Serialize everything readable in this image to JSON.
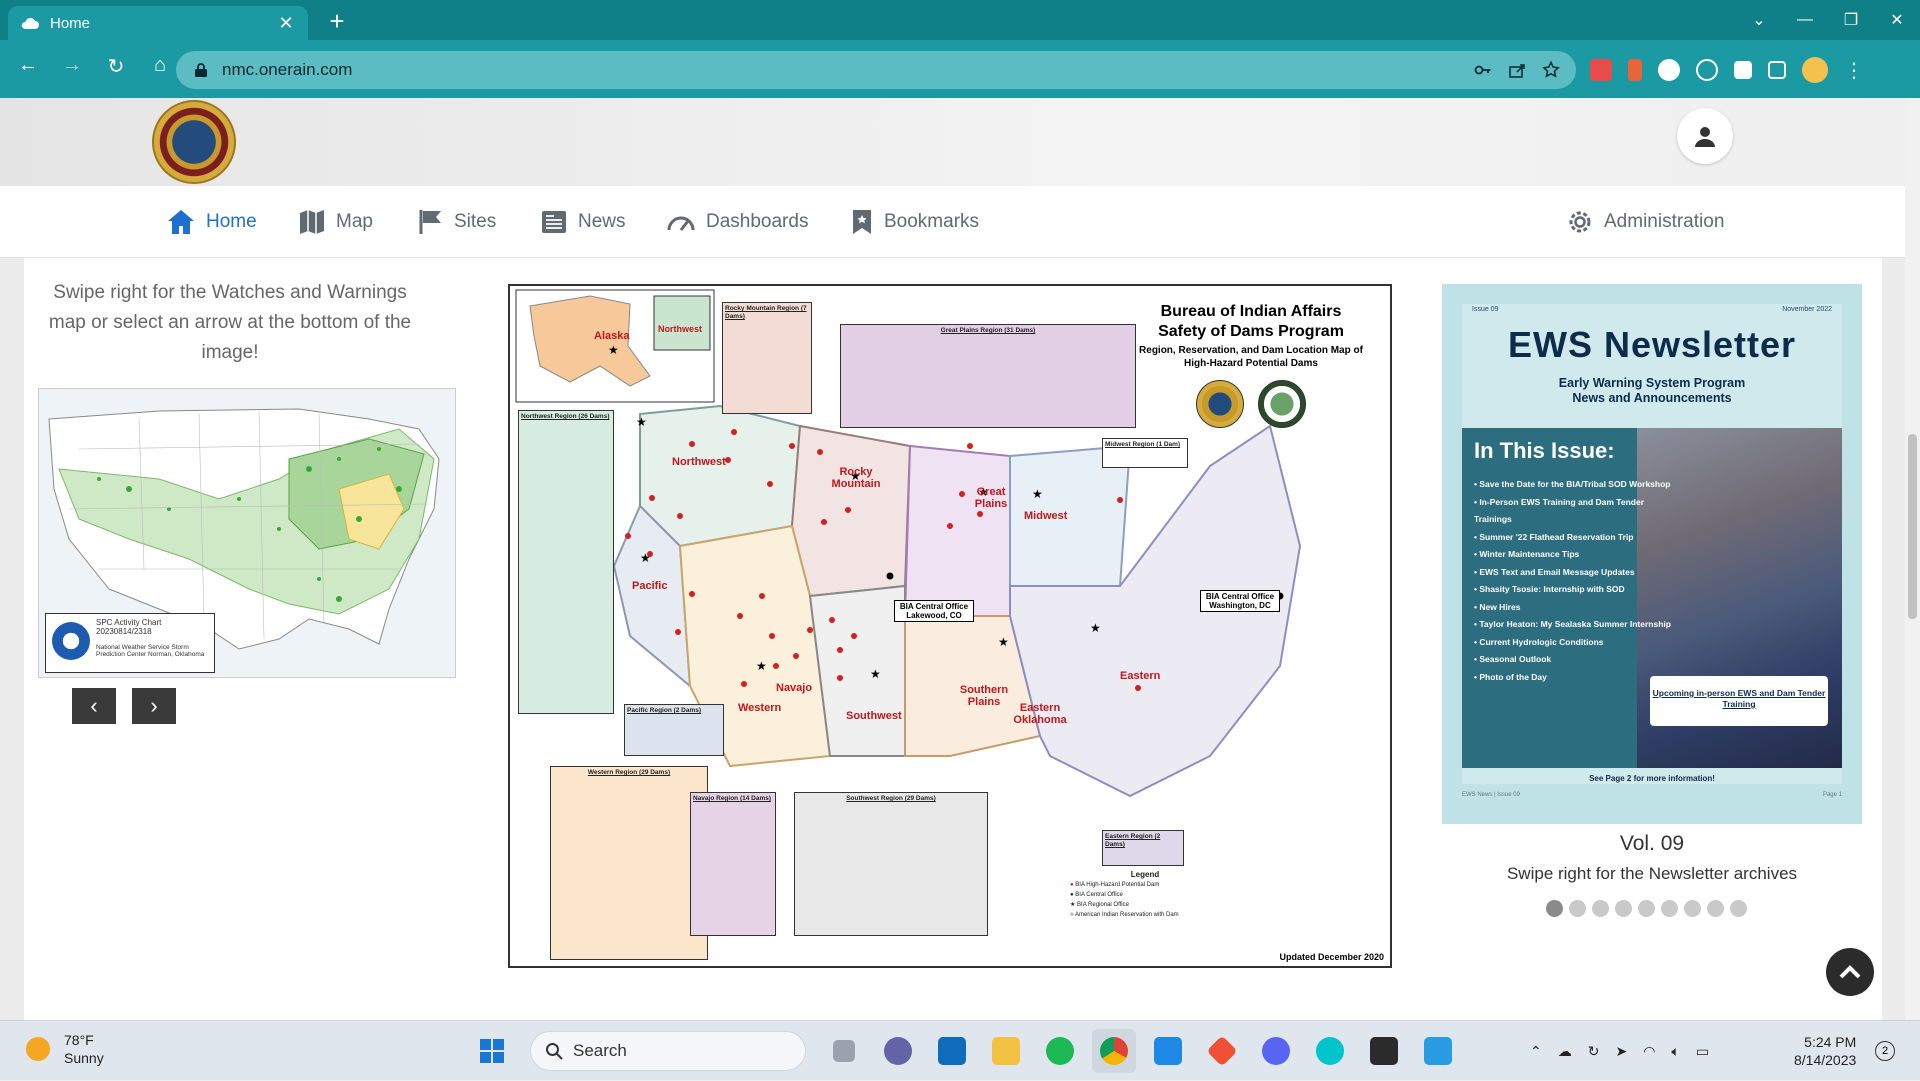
{
  "browser": {
    "tab_title": "Home",
    "url": "nmc.onerain.com",
    "new_tab": "+",
    "close_tab": "✕"
  },
  "nav": {
    "items": [
      {
        "label": "Home",
        "icon": "home-icon",
        "active": true
      },
      {
        "label": "Map",
        "icon": "map-icon"
      },
      {
        "label": "Sites",
        "icon": "flag-icon"
      },
      {
        "label": "News",
        "icon": "newspaper-icon"
      },
      {
        "label": "Dashboards",
        "icon": "gauge-icon"
      },
      {
        "label": "Bookmarks",
        "icon": "bookmark-icon"
      }
    ],
    "admin_label": "Administration"
  },
  "left_panel": {
    "swipe_text": "Swipe right for the Watches and Warnings map or select an arrow at the bottom of the image!",
    "wx_caption_line1": "SPC Activity Chart",
    "wx_caption_line2": "20230814/2318",
    "wx_caption_line3": "National Weather Service",
    "wx_caption_line4": "Storm Prediction Center",
    "wx_caption_line5": "Norman, Oklahoma",
    "prev_arrow": "‹",
    "next_arrow": "›"
  },
  "dam_map": {
    "title_line1": "Bureau of Indian Affairs",
    "title_line2": "Safety of Dams Program",
    "subtitle": "Region, Reservation, and Dam Location Map of High-Hazard Potential Dams",
    "regions": [
      "Alaska",
      "Northwest",
      "Rocky Mountain",
      "Great Plains",
      "Midwest",
      "Pacific",
      "Navajo",
      "Western",
      "Southwest",
      "Southern Plains",
      "Eastern Oklahoma",
      "Eastern"
    ],
    "central_office_1": "BIA Central Office Lakewood, CO",
    "central_office_2": "BIA Central Office Washington, DC",
    "inset_northwest": "Northwest Region (26 Dams)",
    "inset_rocky": "Rocky Mountain Region (7 Dams)",
    "inset_plains": "Great Plains Region (31 Dams)",
    "inset_midwest": "Midwest Region (1 Dam)",
    "inset_pacific": "Pacific Region (2 Dams)",
    "inset_western": "Western Region (29 Dams)",
    "inset_navajo": "Navajo Region (14 Dams)",
    "inset_southwest": "Southwest Region (29 Dams)",
    "inset_eastern": "Eastern Region (2 Dams)",
    "legend_title": "Legend",
    "legend_items": [
      "BIA High-Hazard Potential Dam",
      "BIA Central Office",
      "BIA Regional Office",
      "American Indian Reservation with Dam"
    ],
    "updated": "Updated December 2020"
  },
  "newsletter": {
    "issue": "Issue 09",
    "date": "November 2022",
    "title": "EWS Newsletter",
    "subtitle_1": "Early Warning System Program",
    "subtitle_2": "News and Announcements",
    "in_this_issue": "In This Issue:",
    "items": [
      "Save the Date for the BIA/Tribal SOD Workshop",
      "In-Person EWS Training and Dam Tender Trainings",
      "Summer '22 Flathead Reservation Trip",
      "Winter Maintenance Tips",
      "EWS Text and Email Message Updates",
      "Shasity Tsosie: Internship with SOD",
      "New Hires",
      "Taylor Heaton: My Sealaska Summer Internship",
      "Current Hydrologic Conditions",
      "Seasonal Outlook",
      "Photo of the Day"
    ],
    "cta": "Upcoming in-person EWS and Dam Tender Training",
    "more": "See Page 2 for more information!",
    "footer_left": "EWS News | Issue 09",
    "footer_right": "Page 1",
    "vol": "Vol. 09",
    "swipe": "Swipe right for the Newsletter archives",
    "dot_count": 9,
    "active_dot": 0
  },
  "taskbar": {
    "temp": "78°F",
    "condition": "Sunny",
    "search": "Search",
    "time": "5:24 PM",
    "date": "8/14/2023",
    "notifications": "2"
  }
}
